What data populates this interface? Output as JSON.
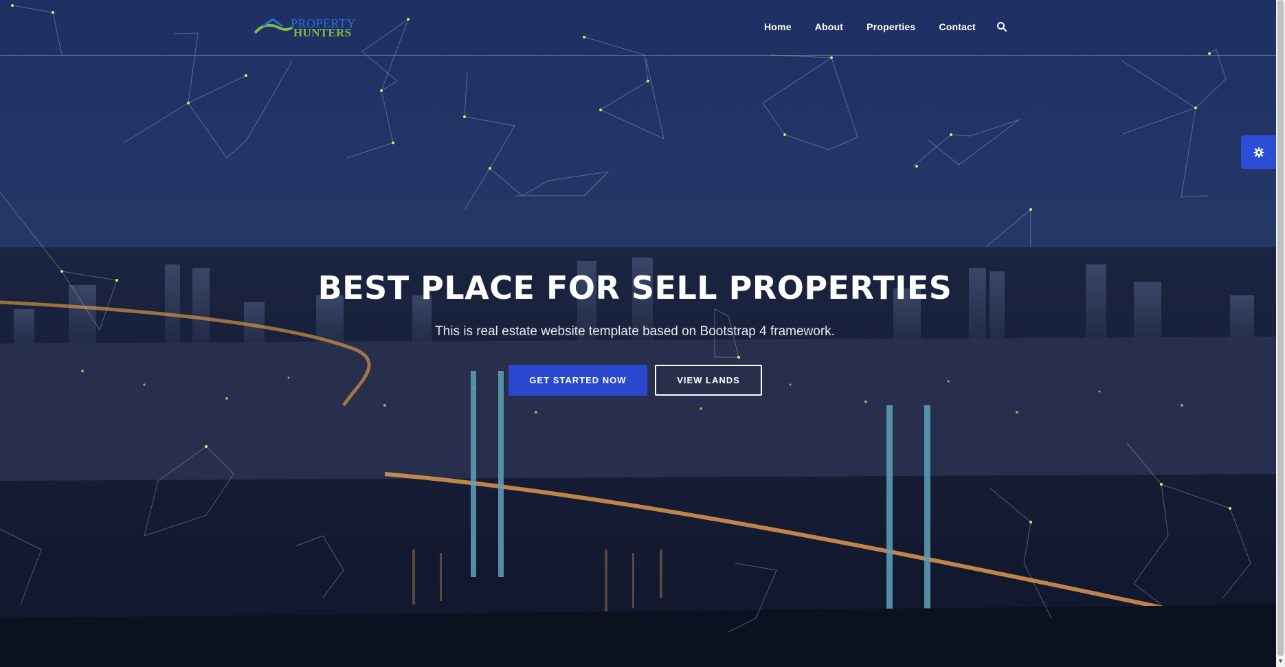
{
  "brand": {
    "logo_line1": "PROPERTY",
    "logo_line2": "HUNTERS"
  },
  "nav": {
    "items": [
      "Home",
      "About",
      "Properties",
      "Contact"
    ],
    "search_icon": "search-icon"
  },
  "settings": {
    "icon": "gear-icon"
  },
  "hero": {
    "title": "BEST PLACE FOR SELL PROPERTIES",
    "subtitle": "This is real estate website template based on Bootstrap 4 framework.",
    "primary_button": "GET STARTED NOW",
    "secondary_button": "VIEW LANDS"
  },
  "colors": {
    "primary": "#2a47d0",
    "overlay": "#1e2f63",
    "logo_blue": "#2b6fd6",
    "logo_green": "#7fbf3a"
  }
}
